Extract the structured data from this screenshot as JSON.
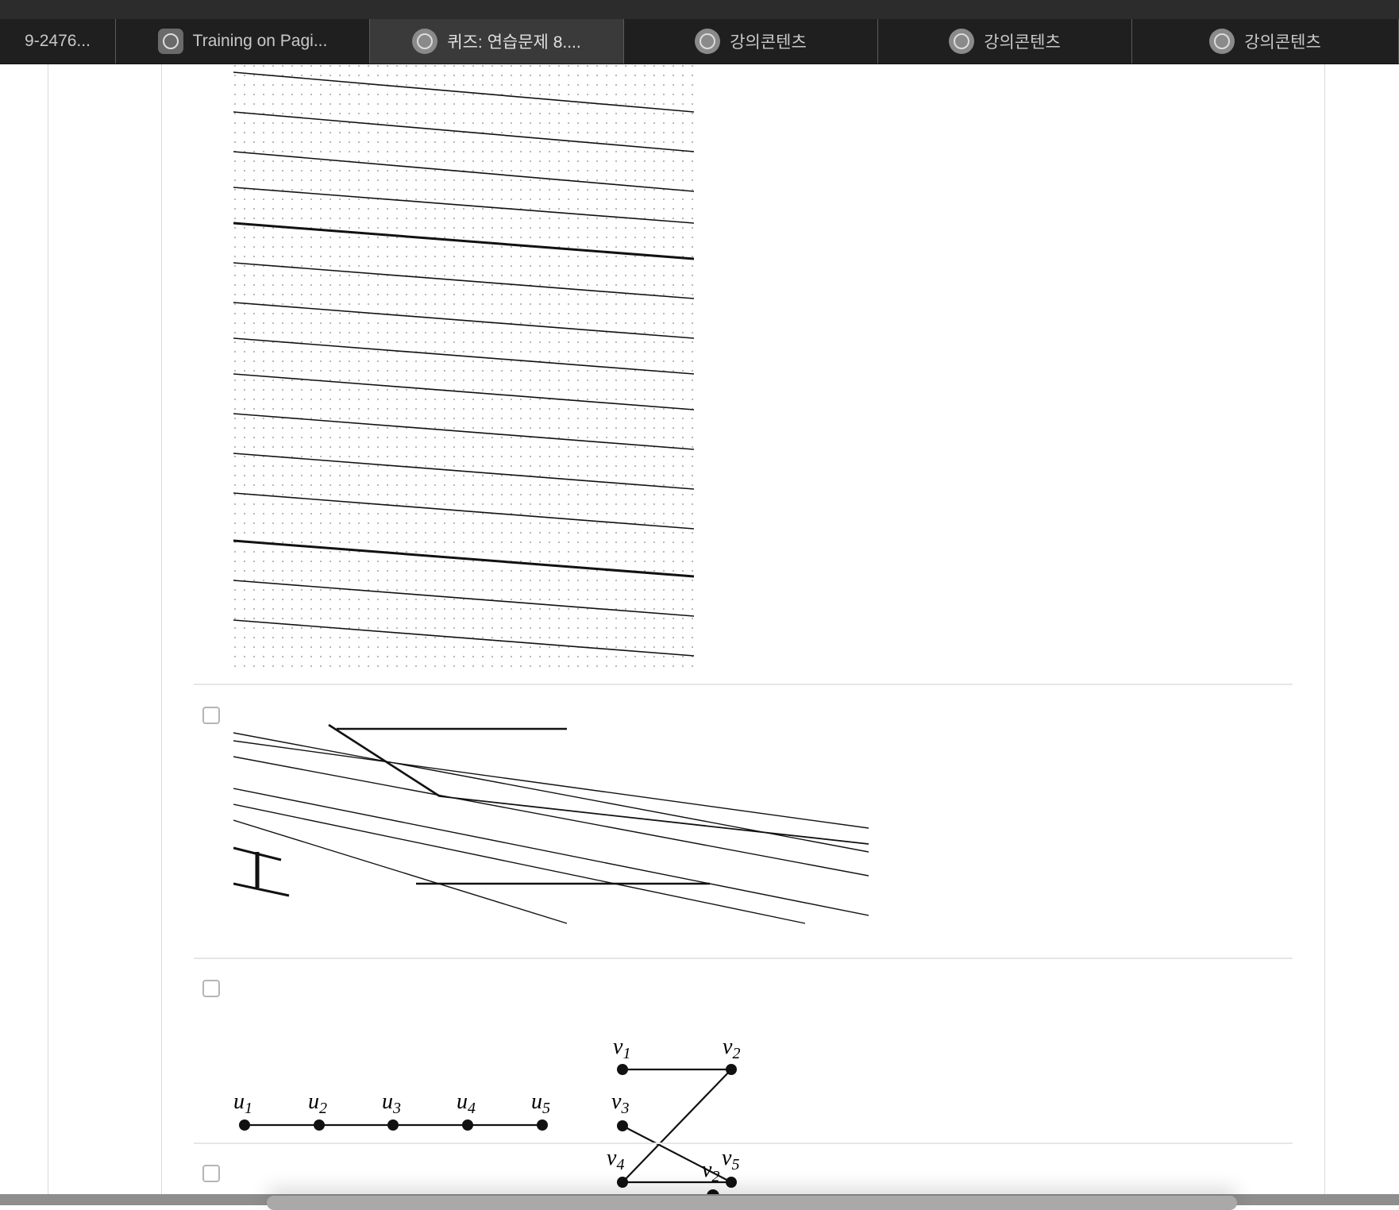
{
  "tabs": [
    {
      "label": "9-2476...",
      "icon": "none",
      "active": false
    },
    {
      "label": "Training on Pagi...",
      "icon": "chatgpt-icon",
      "active": false
    },
    {
      "label": "퀴즈: 연습문제 8....",
      "icon": "university-seal-icon",
      "active": true
    },
    {
      "label": "강의콘텐츠",
      "icon": "university-seal-icon",
      "active": false
    },
    {
      "label": "강의콘텐츠",
      "icon": "university-seal-icon",
      "active": false
    },
    {
      "label": "강의콘텐츠",
      "icon": "university-seal-icon",
      "active": false
    }
  ],
  "graph_option_3": {
    "u_labels": [
      "u",
      "u",
      "u",
      "u",
      "u"
    ],
    "u_subs": [
      "1",
      "2",
      "3",
      "4",
      "5"
    ],
    "v_labels": [
      "v",
      "v",
      "v",
      "v",
      "v"
    ],
    "v_subs": [
      "1",
      "2",
      "3",
      "4",
      "5"
    ]
  },
  "graph_option_4": {
    "v_label": "v",
    "v_sub": "2"
  }
}
